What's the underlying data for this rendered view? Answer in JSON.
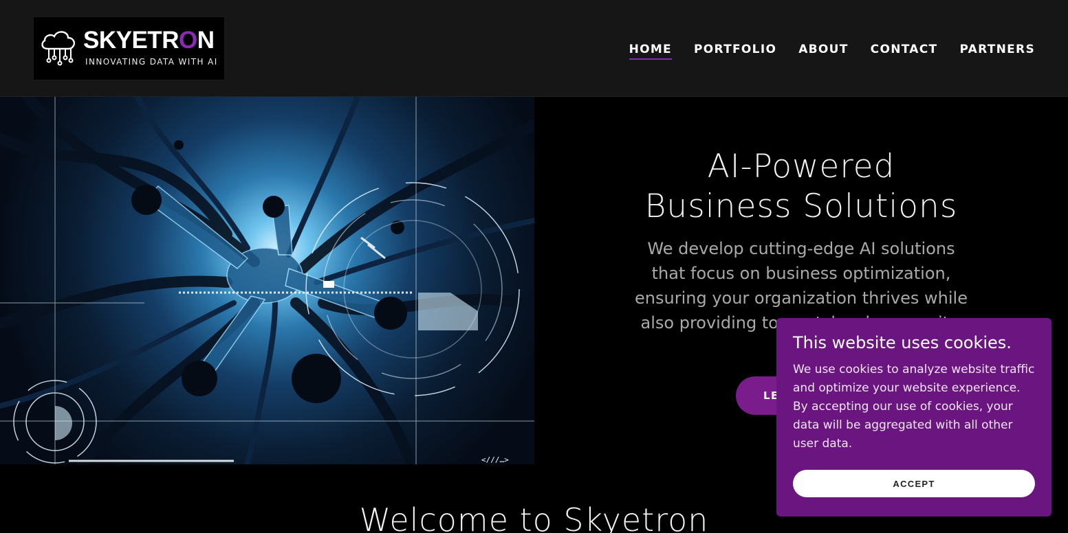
{
  "logo": {
    "wordmark_pre": "SKYETR",
    "wordmark_o": "O",
    "wordmark_post": "N",
    "tagline": "INNOVATING DATA WITH AI"
  },
  "nav": {
    "items": [
      {
        "label": "HOME",
        "active": true
      },
      {
        "label": "PORTFOLIO"
      },
      {
        "label": "ABOUT"
      },
      {
        "label": "CONTACT"
      },
      {
        "label": "PARTNERS"
      }
    ]
  },
  "hero": {
    "title_line1": "AI-Powered",
    "title_line2": "Business Solutions",
    "subtitle": "We develop cutting-edge AI solutions that focus on business optimization, ensuring your organization thrives while also providing top-notch cybersecurity.",
    "cta_label": "LEARN MORE"
  },
  "welcome": {
    "heading": "Welcome to Skyetron"
  },
  "cookie_banner": {
    "title": "This website uses cookies.",
    "body": "We use cookies to analyze website traffic and optimize your website experience. By accepting our use of cookies, your data will be aggregated with all other user data.",
    "accept_label": "ACCEPT"
  },
  "colors": {
    "accent": "#8a2bb6",
    "cta": "#7a1c8c",
    "cookie_bg": "#6b1680",
    "header_bg": "#161616"
  }
}
